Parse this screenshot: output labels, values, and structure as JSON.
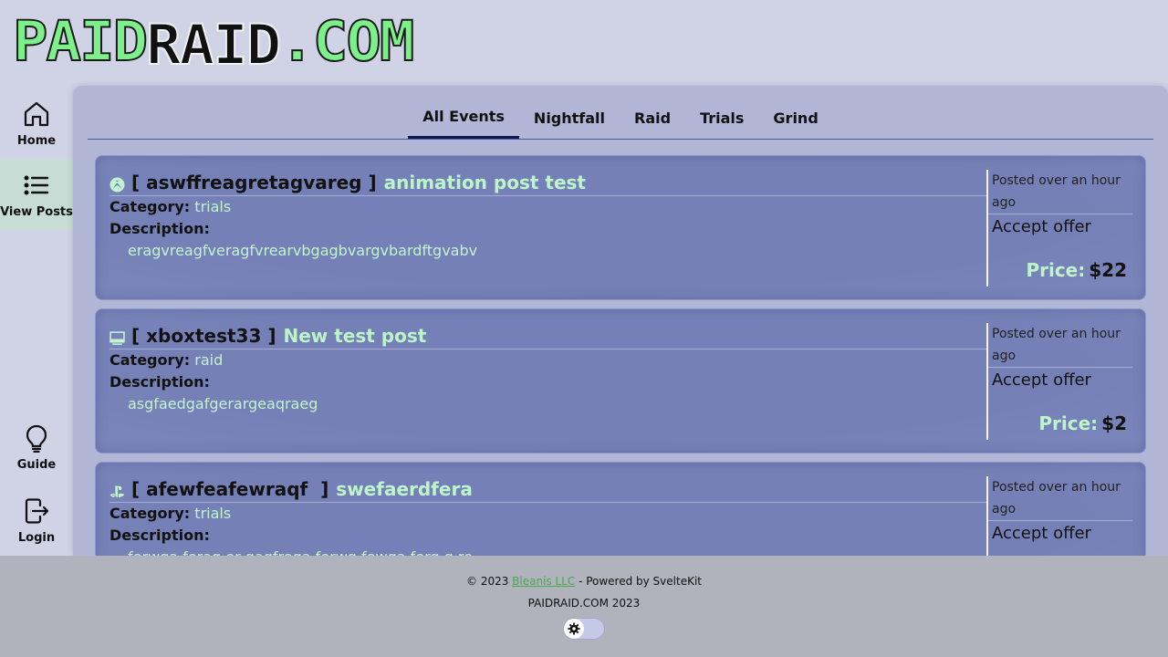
{
  "logo": {
    "part1": "PAID",
    "part2": "RAID",
    "part3": ".COM"
  },
  "sidebar": {
    "items": [
      {
        "label": "Home",
        "icon": "home-icon"
      },
      {
        "label": "View Posts",
        "icon": "list-icon"
      },
      {
        "label": "Guide",
        "icon": "lightbulb-icon"
      },
      {
        "label": "Login",
        "icon": "login-icon"
      }
    ]
  },
  "tabs": [
    "All Events",
    "Nightfall",
    "Raid",
    "Trials",
    "Grind"
  ],
  "labels": {
    "category": "Category:",
    "description": "Description:",
    "price": "Price:",
    "accept": "Accept offer"
  },
  "posts": [
    {
      "platform": "xbox-icon",
      "username": "[ aswffreagretagvareg ]",
      "title": "animation post test",
      "category": "trials",
      "description": "eragvreagfveragfvrearvbgagbvargvbardftgvabv",
      "posted": "Posted over an hour ago",
      "price": "$22"
    },
    {
      "platform": "pc-icon",
      "username": "[ xboxtest33 ]",
      "title": "New test post",
      "category": "raid",
      "description": "asgfaedgafgerargeaqraeg",
      "posted": "Posted over an hour ago",
      "price": "$2"
    },
    {
      "platform": "playstation-icon",
      "username": "[ afewfeafewraqf  ]",
      "title": "swefaerdfera",
      "category": "trials",
      "description": "ferwga feraq er gaqfrega ferwg fewga ferg g re",
      "posted": "Posted over an hour ago",
      "price": ""
    }
  ],
  "footer": {
    "copyright": "© 2023 ",
    "company": "Bleanis LLC",
    "powered": " - Powered by SvelteKit",
    "line2": "PAIDRAID.COM 2023"
  }
}
